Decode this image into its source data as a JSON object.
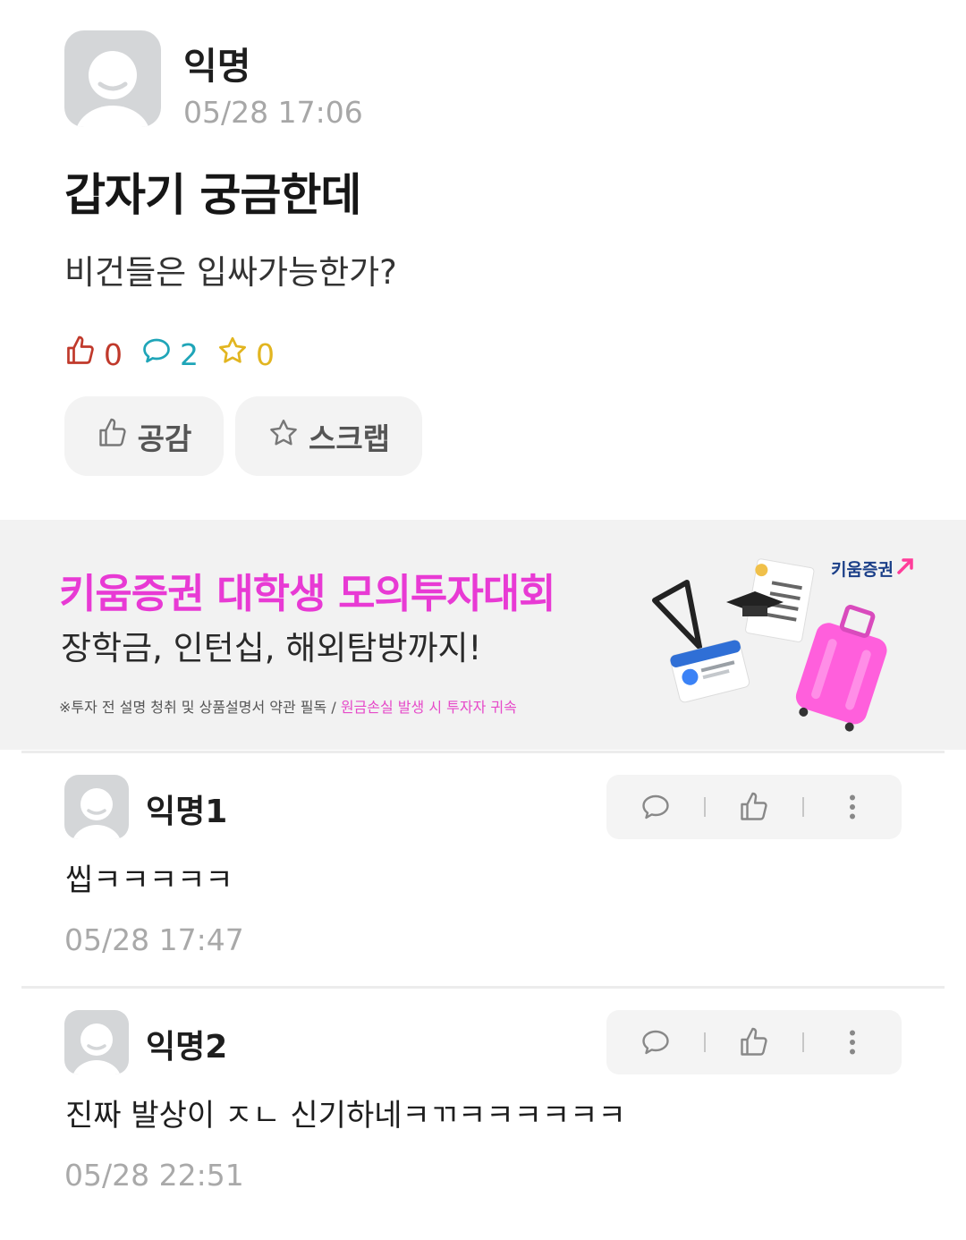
{
  "post": {
    "author": "익명",
    "time": "05/28 17:06",
    "title": "갑자기 궁금한데",
    "body": "비건들은 입싸가능한가?",
    "stats": {
      "likes": "0",
      "comments": "2",
      "scraps": "0"
    },
    "buttons": {
      "like_label": "공감",
      "scrap_label": "스크랩"
    }
  },
  "ad": {
    "headline": "키움증권 대학생 모의투자대회",
    "subtext": "장학금, 인턴십, 해외탐방까지!",
    "disclaimer_gray": "※투자 전 설명 청취 및 상품설명서 약관 필독 /",
    "disclaimer_pink": "원금손실 발생 시 투자자 귀속",
    "logo": "키움증권",
    "colors": {
      "headline": "#e83ad4",
      "logo": "#1b3f88",
      "accent": "#ff4fd8"
    }
  },
  "comments": [
    {
      "author": "익명1",
      "text": "씹ㅋㅋㅋㅋㅋ",
      "time": "05/28 17:47"
    },
    {
      "author": "익명2",
      "text": "진짜 발상이 ㅈㄴ 신기하네ㅋㄲㅋㅋㅋㅋㅋㅋ",
      "time": "05/28 22:51"
    }
  ],
  "icons": {
    "avatar": "default-avatar-icon",
    "like": "thumbs-up-icon",
    "comment": "speech-bubble-icon",
    "scrap": "star-icon",
    "more": "more-vertical-icon"
  },
  "theme": {
    "like": "#c0392b",
    "comment": "#1fa5b8",
    "scrap": "#e2b520"
  }
}
